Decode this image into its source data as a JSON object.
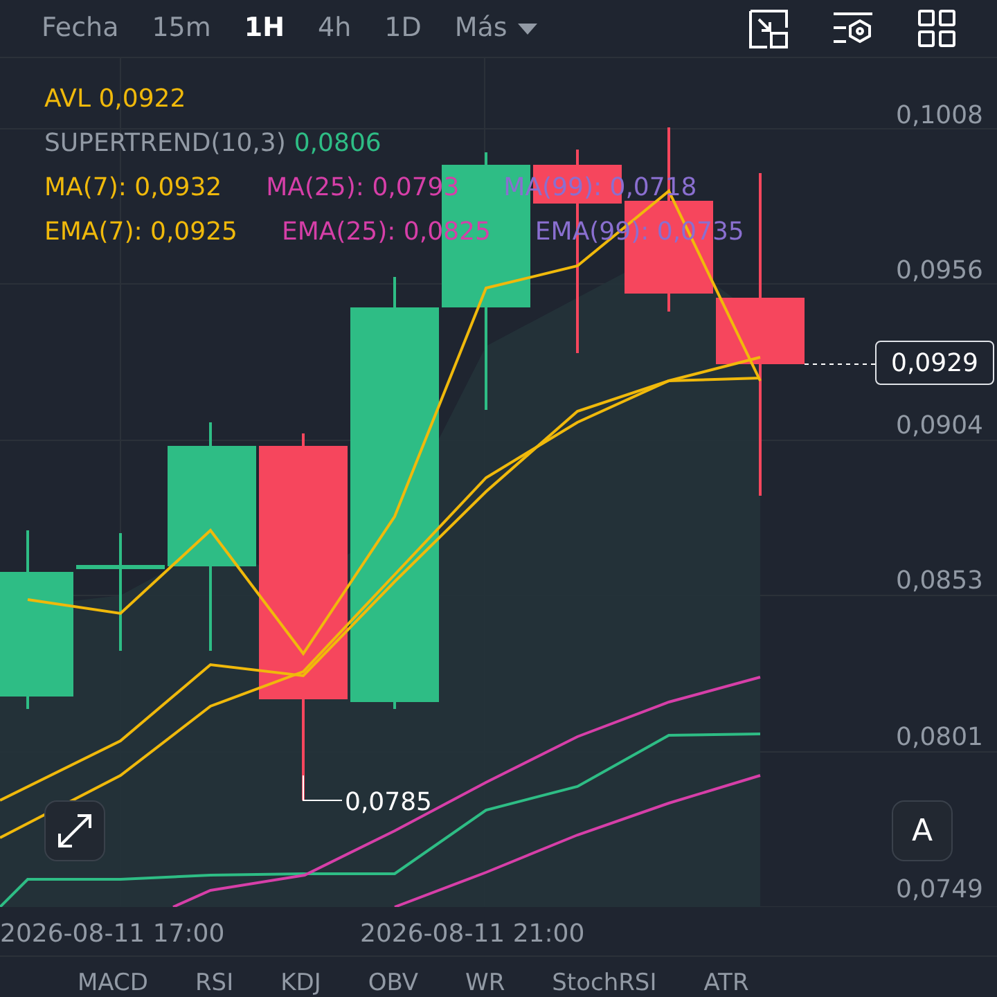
{
  "toolbar": {
    "intervals": [
      {
        "label": "Fecha",
        "selected": false,
        "kind": "tab"
      },
      {
        "label": "15m",
        "selected": false,
        "kind": "tab"
      },
      {
        "label": "1H",
        "selected": true,
        "kind": "tab"
      },
      {
        "label": "4h",
        "selected": false,
        "kind": "tab"
      },
      {
        "label": "1D",
        "selected": false,
        "kind": "tab"
      },
      {
        "label": "Más",
        "selected": false,
        "kind": "dropdown"
      }
    ]
  },
  "legend": [
    [
      {
        "text": "AVL 0,0922",
        "color": "#f0b90b"
      }
    ],
    [
      {
        "text": "SUPERTREND(10,3)",
        "color": "#929aa5"
      },
      {
        "text": "0,0806",
        "color": "#2ebd85"
      }
    ],
    [
      {
        "text": "MA(7): 0,0932",
        "color": "#f0b90b"
      },
      {
        "text": "MA(25): 0,0793",
        "color": "#d63fa8"
      },
      {
        "text": "MA(99): 0,0718",
        "color": "#8a6fd0"
      }
    ],
    [
      {
        "text": "EMA(7): 0,0925",
        "color": "#f0b90b"
      },
      {
        "text": "EMA(25): 0,0825",
        "color": "#d63fa8"
      },
      {
        "text": "EMA(99): 0,0735",
        "color": "#8a6fd0"
      }
    ]
  ],
  "price_axis": [
    "0,1008",
    "0,0956",
    "0,0904",
    "0,0853",
    "0,0801",
    "0,0749"
  ],
  "current_price": "0,0929",
  "low_marker": "0,0785",
  "scale_button": "A",
  "time_axis": [
    "2026-08-11 17:00",
    "2026-08-11 21:00"
  ],
  "indicator_tabs": [
    "MACD",
    "RSI",
    "KDJ",
    "OBV",
    "WR",
    "StochRSI",
    "ATR"
  ]
}
